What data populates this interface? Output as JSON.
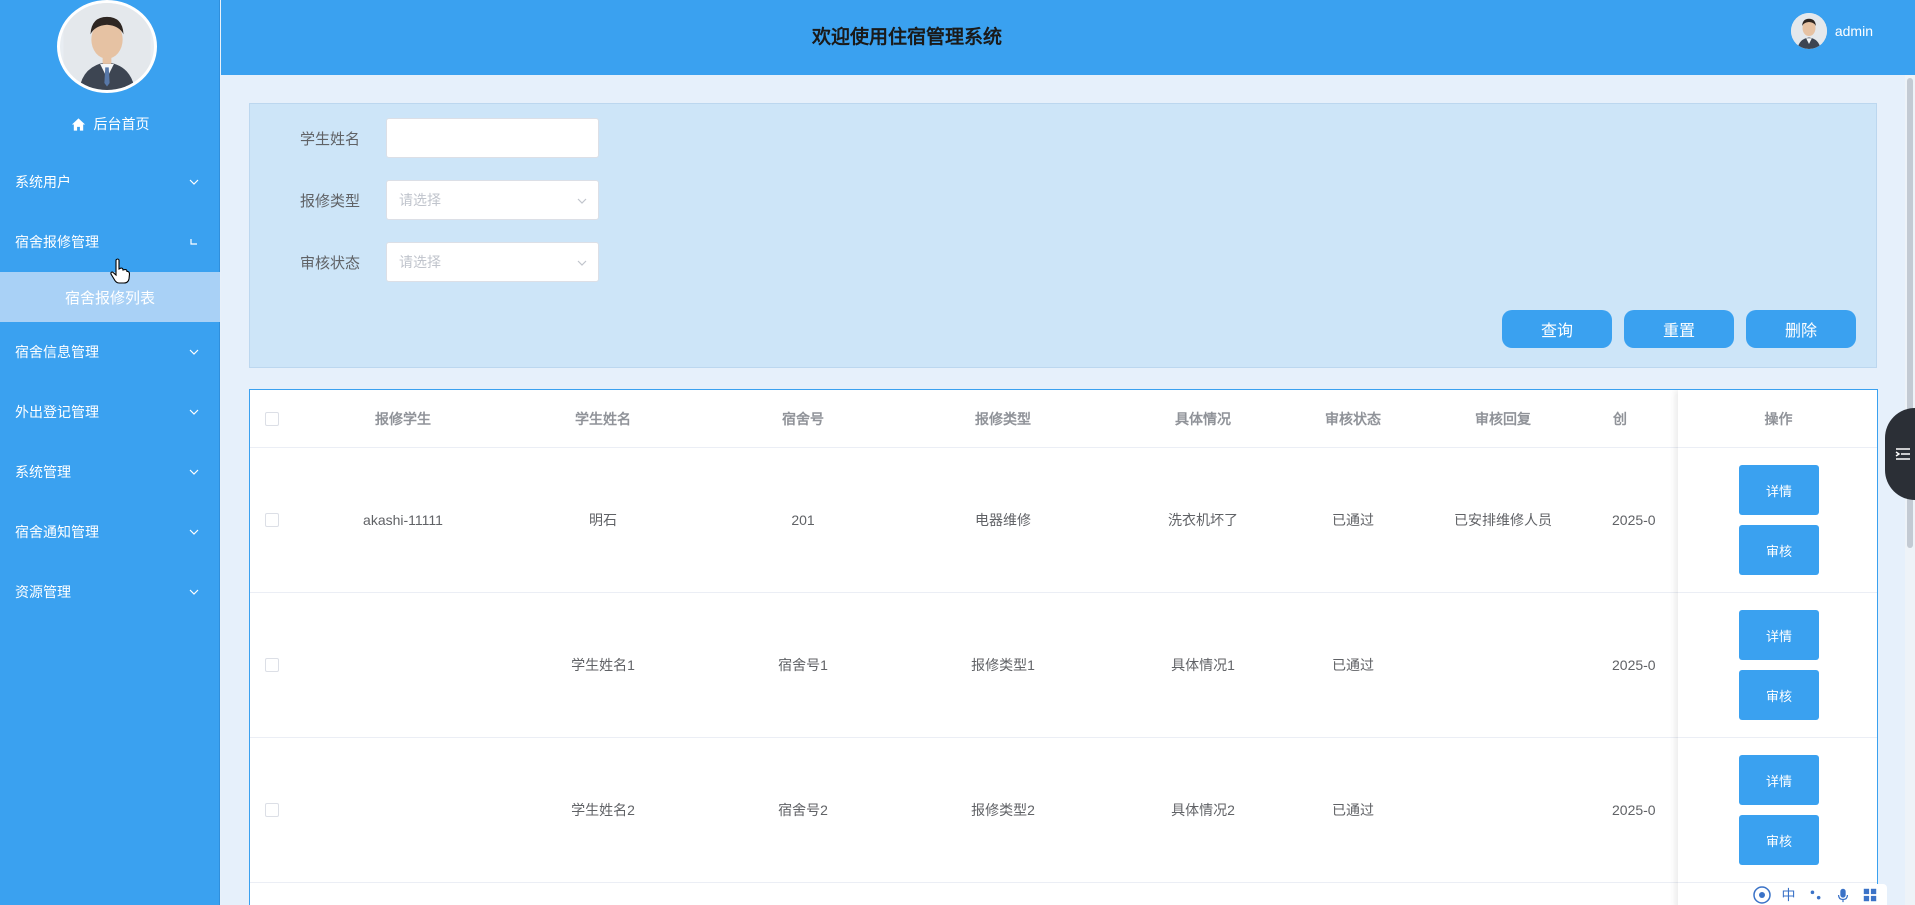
{
  "sidebar": {
    "home": "后台首页",
    "menu": [
      {
        "label": "系统用户"
      },
      {
        "label": "宿舍报修管理"
      },
      {
        "label": "宿舍信息管理"
      },
      {
        "label": "外出登记管理"
      },
      {
        "label": "系统管理"
      },
      {
        "label": "宿舍通知管理"
      },
      {
        "label": "资源管理"
      }
    ],
    "submenu_active": "宿舍报修列表"
  },
  "header": {
    "title": "欢迎使用住宿管理系统",
    "username": "admin"
  },
  "search": {
    "student_name_label": "学生姓名",
    "student_name_value": "",
    "repair_type_label": "报修类型",
    "repair_type_placeholder": "请选择",
    "audit_status_label": "审核状态",
    "audit_status_placeholder": "请选择",
    "query_button": "查询",
    "reset_button": "重置",
    "delete_button": "删除"
  },
  "table": {
    "columns": [
      "报修学生",
      "学生姓名",
      "宿舍号",
      "报修类型",
      "具体情况",
      "审核状态",
      "审核回复",
      "创"
    ],
    "actions_header": "操作",
    "rows": [
      {
        "student": "akashi-11111",
        "name": "明石",
        "room": "201",
        "type": "电器维修",
        "detail": "洗衣机坏了",
        "status": "已通过",
        "reply": "已安排维修人员",
        "created": "2025-0"
      },
      {
        "student": "",
        "name": "学生姓名1",
        "room": "宿舍号1",
        "type": "报修类型1",
        "detail": "具体情况1",
        "status": "已通过",
        "reply": "",
        "created": "2025-0"
      },
      {
        "student": "",
        "name": "学生姓名2",
        "room": "宿舍号2",
        "type": "报修类型2",
        "detail": "具体情况2",
        "status": "已通过",
        "reply": "",
        "created": "2025-0"
      }
    ],
    "detail_button": "详情",
    "audit_button": "审核"
  },
  "ime": {
    "lang": "中"
  },
  "colors": {
    "primary": "#3aa1f0",
    "panel": "#cde5f8",
    "submenu_active_bg": "#a9d1f6"
  }
}
